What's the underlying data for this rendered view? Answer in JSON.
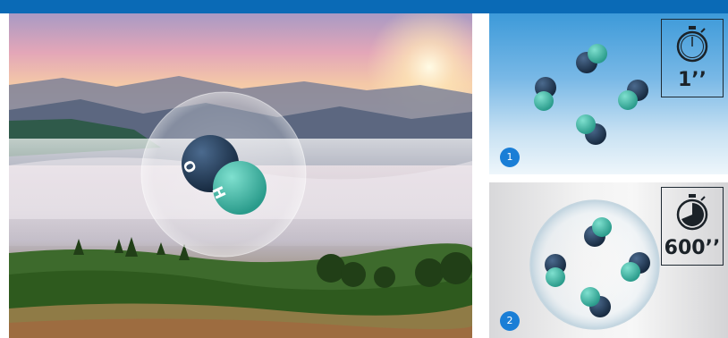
{
  "top_bar": {
    "color": "#0a6ab6"
  },
  "hero": {
    "scene": "misty-mountain-sunrise",
    "molecule_atoms": [
      "O",
      "H"
    ],
    "bubble": true
  },
  "panels": [
    {
      "step": "1",
      "timer": "1’’",
      "icon": "stopwatch-icon-empty",
      "molecule_count": 4
    },
    {
      "step": "2",
      "timer": "600’’",
      "icon": "stopwatch-icon-filled",
      "molecule_count": 4
    }
  ],
  "colors": {
    "oxygen": "#1f3550",
    "hydrogen": "#3fb5a3",
    "badge": "#1a7ed6"
  }
}
